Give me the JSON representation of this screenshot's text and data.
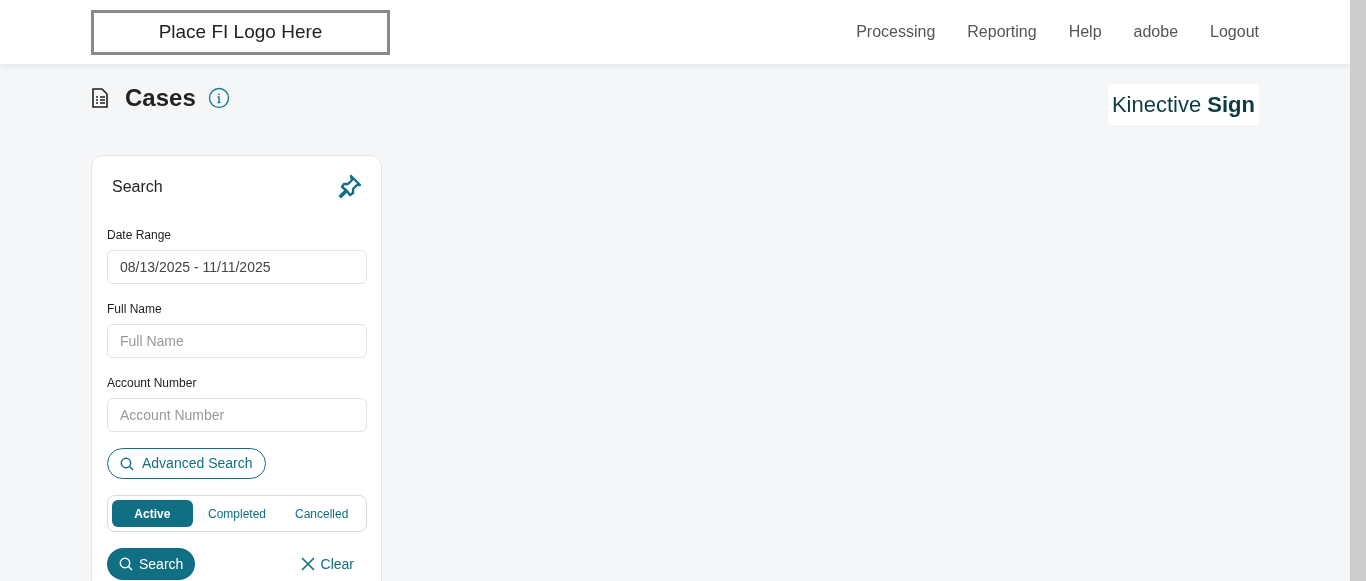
{
  "header": {
    "logo": "Place FI Logo Here",
    "nav": [
      "Processing",
      "Reporting",
      "Help",
      "adobe",
      "Logout"
    ]
  },
  "page": {
    "title": "Cases",
    "brand": "Kinective **Sign**"
  },
  "search_panel": {
    "title": "Search",
    "fields": [
      {
        "label": "Date Range",
        "value": "08/13/2025 - 11/11/2025"
      },
      {
        "label": "Full Name",
        "placeholder": "Full Name"
      },
      {
        "label": "Account Number",
        "placeholder": "Account Number"
      }
    ],
    "advanced_search": "Advanced Search",
    "status_tabs": [
      {
        "label": "Active",
        "selected": true
      },
      {
        "label": "Completed",
        "selected": false
      },
      {
        "label": "Cancelled",
        "selected": false
      }
    ],
    "search_button": "Search",
    "clear_button": "Clear"
  }
}
